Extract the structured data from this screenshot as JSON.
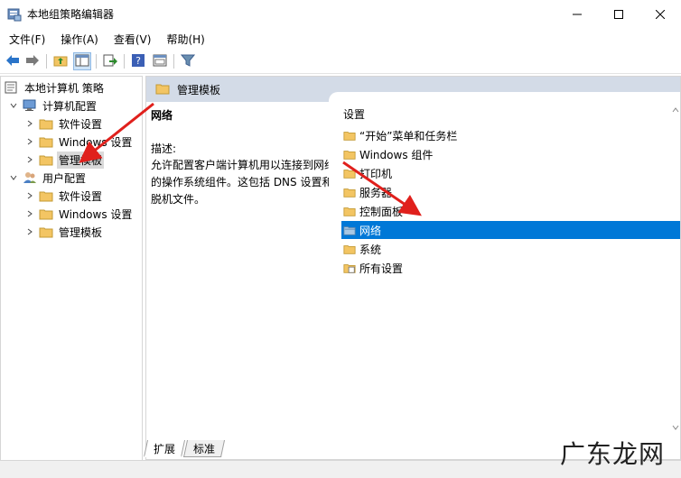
{
  "window": {
    "title": "本地组策略编辑器",
    "controls": {
      "minimize": "minimize-icon",
      "maximize": "maximize-icon",
      "close": "close-icon"
    }
  },
  "menu": [
    {
      "label": "文件(F)"
    },
    {
      "label": "操作(A)"
    },
    {
      "label": "查看(V)"
    },
    {
      "label": "帮助(H)"
    }
  ],
  "toolbar": {
    "icons": [
      "back-icon",
      "forward-icon",
      "up-folder-icon",
      "show-hide-tree-icon",
      "export-icon",
      "help-icon",
      "properties-icon",
      "filter-icon"
    ]
  },
  "tree": {
    "root": "本地计算机 策略",
    "computer_config": "计算机配置",
    "computer_children": [
      "软件设置",
      "Windows 设置",
      "管理模板"
    ],
    "user_config": "用户配置",
    "user_children": [
      "软件设置",
      "Windows 设置",
      "管理模板"
    ]
  },
  "right_pane": {
    "header": "管理模板",
    "selected_title": "网络",
    "description_label": "描述:",
    "description_text": "允许配置客户端计算机用以连接到网络的操作系统组件。这包括 DNS 设置和脱机文件。",
    "list_header": "设置",
    "items": [
      {
        "label": "“开始”菜单和任务栏",
        "icon": "folder-icon"
      },
      {
        "label": "Windows 组件",
        "icon": "folder-icon"
      },
      {
        "label": "打印机",
        "icon": "folder-icon"
      },
      {
        "label": "服务器",
        "icon": "folder-icon"
      },
      {
        "label": "控制面板",
        "icon": "folder-icon"
      },
      {
        "label": "网络",
        "icon": "folder-open-icon"
      },
      {
        "label": "系统",
        "icon": "folder-icon"
      },
      {
        "label": "所有设置",
        "icon": "all-settings-icon"
      }
    ],
    "selected_index": 5
  },
  "tabs": [
    {
      "label": "扩展"
    },
    {
      "label": "标准"
    }
  ],
  "watermark": "广东龙网",
  "colors": {
    "selection": "#0078d7",
    "header_bg": "#d3dbe7",
    "annotation_arrow": "#e0201c",
    "folder": "#f3c563"
  }
}
